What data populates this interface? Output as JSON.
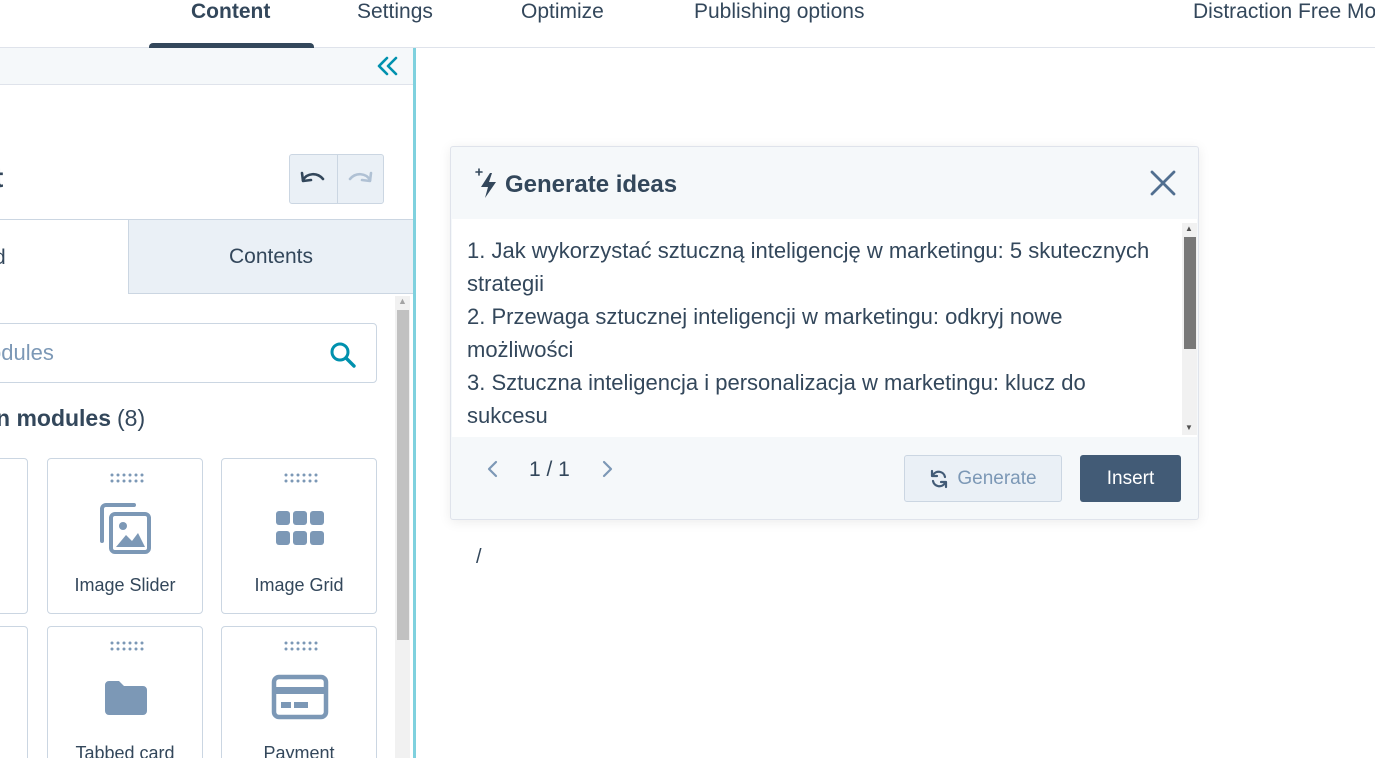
{
  "top_nav": {
    "tabs": [
      {
        "label": "Content"
      },
      {
        "label": "Settings"
      },
      {
        "label": "Optimize"
      },
      {
        "label": "Publishing options"
      },
      {
        "label": "Distraction Free Mo"
      }
    ]
  },
  "sidebar": {
    "title": "t",
    "subtabs": {
      "add": "d",
      "contents": "Contents"
    },
    "search": {
      "placeholder": "odules"
    },
    "modules_heading": {
      "label": "n modules",
      "count": "(8)"
    },
    "cards": [
      {
        "label": "Image Slider",
        "icon": "image-slider-icon"
      },
      {
        "label": "Image Grid",
        "icon": "grid-icon"
      },
      {
        "label": "Tabbed card",
        "icon": "folder-icon"
      },
      {
        "label": "Payment",
        "icon": "payment-card-icon"
      }
    ]
  },
  "dialog": {
    "title": "Generate ideas",
    "ideas": "1. Jak wykorzystać sztuczną inteligencję w marketingu: 5 skutecznych strategii\n2. Przewaga sztucznej inteligencji w marketingu: odkryj nowe możliwości\n3. Sztuczna inteligencja i personalizacja w marketingu: klucz do sukcesu",
    "pager": "1 / 1",
    "generate_label": "Generate",
    "insert_label": "Insert"
  },
  "editor": {
    "text": "/"
  },
  "colors": {
    "accent": "#0091ae",
    "dark": "#33475b",
    "primary_button": "#425b76"
  }
}
